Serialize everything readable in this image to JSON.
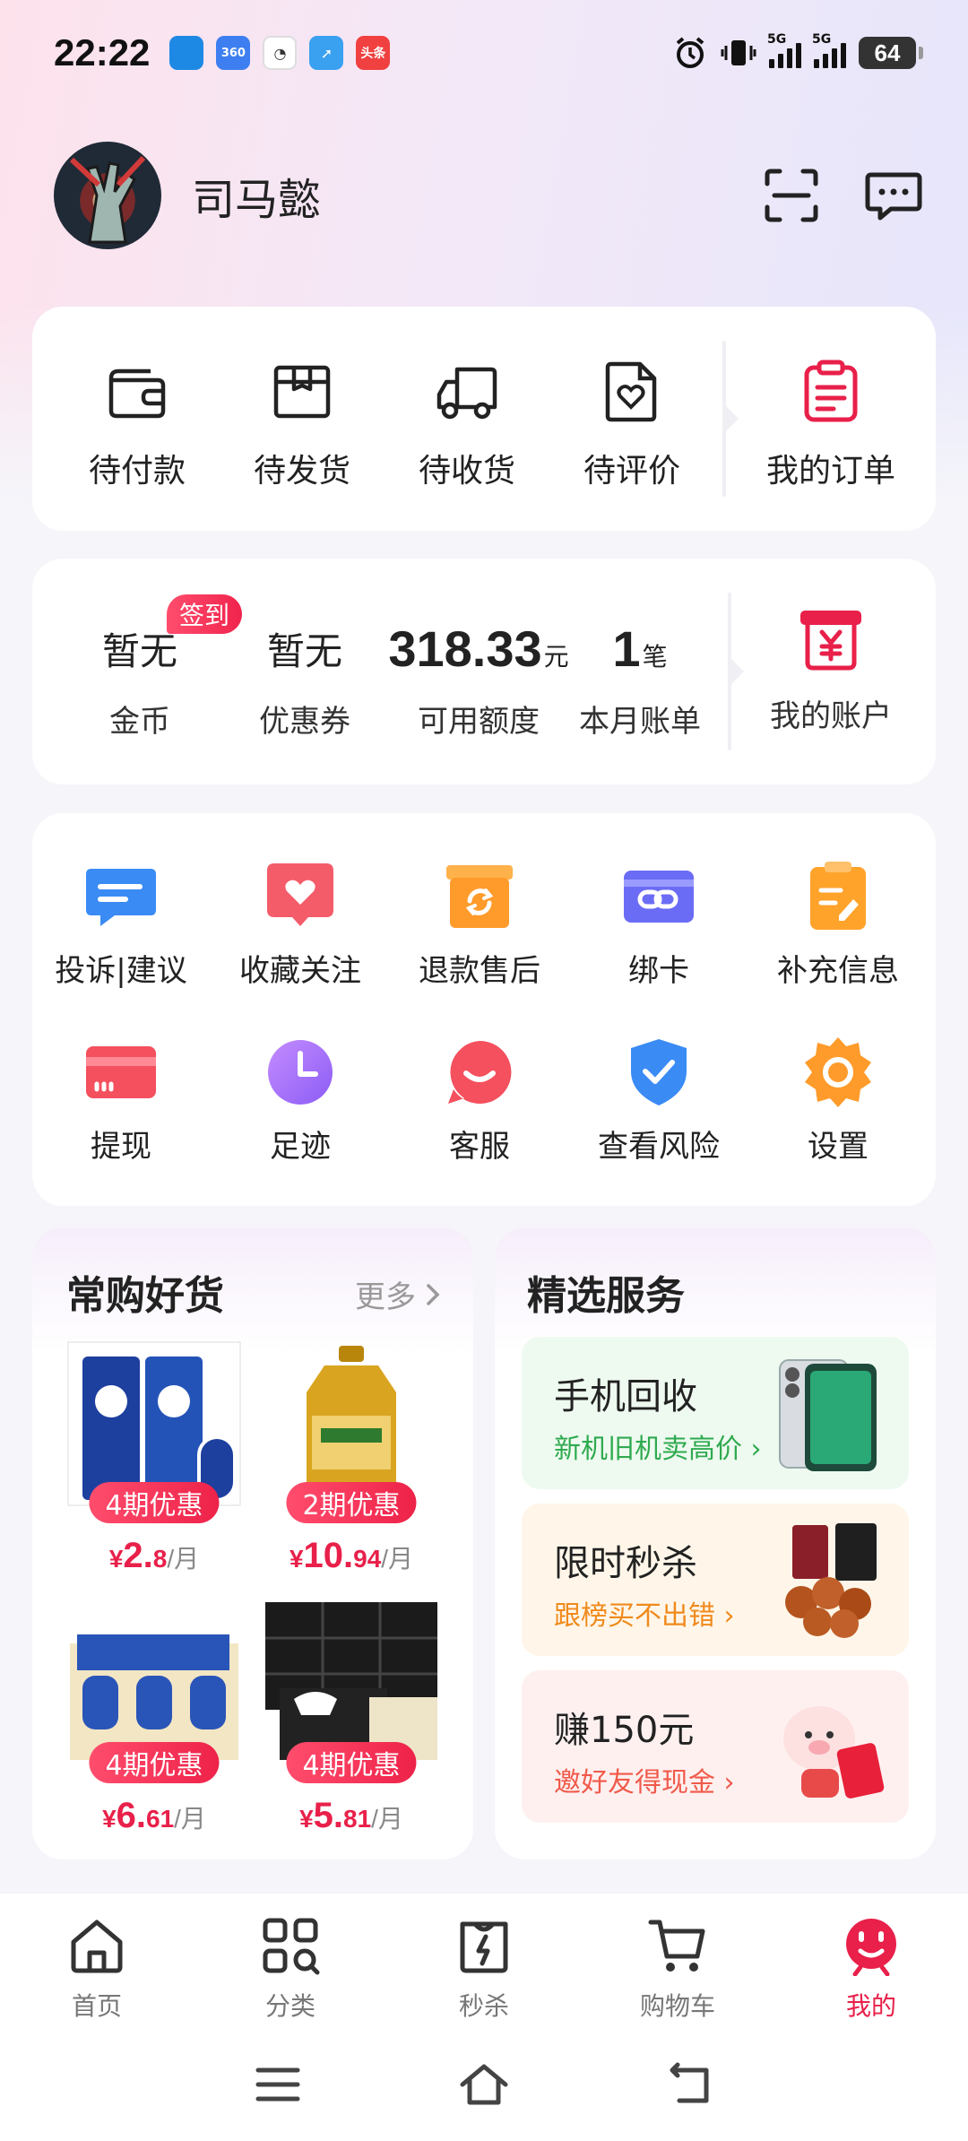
{
  "status_bar": {
    "time": "22:22",
    "notification_apps": [
      "app-icon",
      "baidu-360-icon",
      "clock-icon",
      "browser-icon",
      "toutiao-icon"
    ],
    "notif_labels": [
      "",
      "360",
      "",
      "",
      "头条"
    ],
    "signal_tags": [
      "5G",
      "5G"
    ],
    "battery": "64"
  },
  "profile": {
    "username": "司马懿"
  },
  "orders": {
    "items": [
      {
        "label": "待付款",
        "icon": "wallet-icon"
      },
      {
        "label": "待发货",
        "icon": "package-icon"
      },
      {
        "label": "待收货",
        "icon": "truck-icon"
      },
      {
        "label": "待评价",
        "icon": "review-icon"
      }
    ],
    "all_orders": {
      "label": "我的订单",
      "icon": "order-list-icon"
    }
  },
  "account": {
    "signin_badge": "签到",
    "items": [
      {
        "value": "暂无",
        "label": "金币"
      },
      {
        "value": "暂无",
        "label": "优惠券"
      },
      {
        "value": "318.33",
        "unit": "元",
        "label": "可用额度"
      },
      {
        "value": "1",
        "unit": "笔",
        "label": "本月账单"
      }
    ],
    "my_account": {
      "label": "我的账户",
      "icon": "yen-bill-icon"
    }
  },
  "services": {
    "items": [
      {
        "label": "投诉|建议",
        "icon": "chat-bubble-icon",
        "color": "#3b8bf5"
      },
      {
        "label": "收藏关注",
        "icon": "heart-icon",
        "color": "#f45c6a"
      },
      {
        "label": "退款售后",
        "icon": "refund-box-icon",
        "color": "#ff9b2b"
      },
      {
        "label": "绑卡",
        "icon": "link-card-icon",
        "color": "#6b6cf5"
      },
      {
        "label": "补充信息",
        "icon": "edit-doc-icon",
        "color": "#ffa32b"
      },
      {
        "label": "提现",
        "icon": "card-icon",
        "color": "#f4505e"
      },
      {
        "label": "足迹",
        "icon": "clock-icon",
        "color": "#a46cf5"
      },
      {
        "label": "客服",
        "icon": "smile-icon",
        "color": "#f4505e"
      },
      {
        "label": "查看风险",
        "icon": "shield-check-icon",
        "color": "#3b8bf5"
      },
      {
        "label": "设置",
        "icon": "gear-icon",
        "color": "#ff9b2b"
      }
    ]
  },
  "goods": {
    "title": "常购好货",
    "more": "更多",
    "products": [
      {
        "badge": "4期优惠",
        "currency": "¥",
        "int": "2.",
        "dec": "8",
        "per": "/月"
      },
      {
        "badge": "2期优惠",
        "currency": "¥",
        "int": "10.",
        "dec": "94",
        "per": "/月"
      },
      {
        "badge": "4期优惠",
        "currency": "¥",
        "int": "6.",
        "dec": "61",
        "per": "/月"
      },
      {
        "badge": "4期优惠",
        "currency": "¥",
        "int": "5.",
        "dec": "81",
        "per": "/月"
      }
    ]
  },
  "featured": {
    "title": "精选服务",
    "items": [
      {
        "title": "手机回收",
        "subtitle": "新机旧机卖高价",
        "bg": "#eefaf0",
        "sub_color": "#2faa4f"
      },
      {
        "title": "限时秒杀",
        "subtitle": "跟榜买不出错",
        "bg": "#fff6e9",
        "sub_color": "#f08a1c"
      },
      {
        "title": "赚150元",
        "subtitle": "邀好友得现金",
        "bg": "#fff0f0",
        "sub_color": "#f05a4a"
      }
    ]
  },
  "tabbar": {
    "items": [
      {
        "label": "首页",
        "icon": "home-icon"
      },
      {
        "label": "分类",
        "icon": "category-icon"
      },
      {
        "label": "秒杀",
        "icon": "flash-bag-icon"
      },
      {
        "label": "购物车",
        "icon": "cart-icon"
      },
      {
        "label": "我的",
        "icon": "mine-icon",
        "active": true
      }
    ]
  },
  "colors": {
    "accent": "#e8204a",
    "text": "#222222"
  }
}
